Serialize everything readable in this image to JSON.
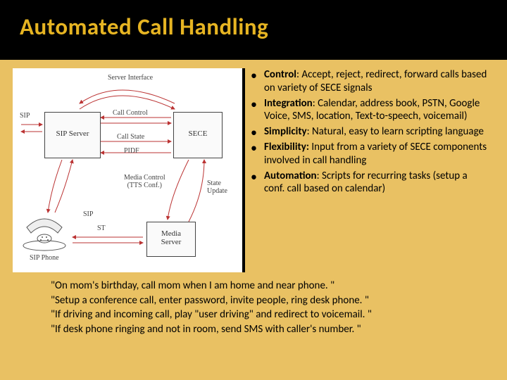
{
  "title": "Automated Call Handling",
  "diagram": {
    "serverInterface": "Server Interface",
    "sip": "SIP",
    "sipServer": "SIP Server",
    "callControl": "Call Control",
    "callState": "Call State",
    "pidf": "PIDF",
    "sece": "SECE",
    "mediaControl": "Media Control\n(TTS Conf.)",
    "stateUpdate": "State\nUpdate",
    "slp": "SIP",
    "st": "ST",
    "mediaServer": "Media\nServer",
    "sipPhone": "SIP Phone"
  },
  "bullets": [
    {
      "label": "Control",
      "text": ": Accept, reject, redirect, forward calls based on variety of SECE signals"
    },
    {
      "label": "Integration",
      "text": ": Calendar, address book, PSTN, Google Voice, SMS, location, Text-to-speech, voicemail)"
    },
    {
      "label": "Simplicity",
      "text": ": Natural, easy to learn scripting language"
    },
    {
      "label": "Flexibility:",
      "text": " Input from a variety of SECE components   involved in call handling"
    },
    {
      "label": "Automation",
      "text": ": Scripts for recurring tasks (setup a conf. call based on calendar)"
    }
  ],
  "quotes": [
    "\"On mom's birthday, call mom when I am home and near phone. \"",
    "\"Setup a conference call, enter password, invite people, ring desk phone. \"",
    "\"If driving and incoming call, play \"user driving\" and redirect to voicemail. \"",
    "\"If desk phone ringing and not in room, send SMS with caller's number. \""
  ]
}
